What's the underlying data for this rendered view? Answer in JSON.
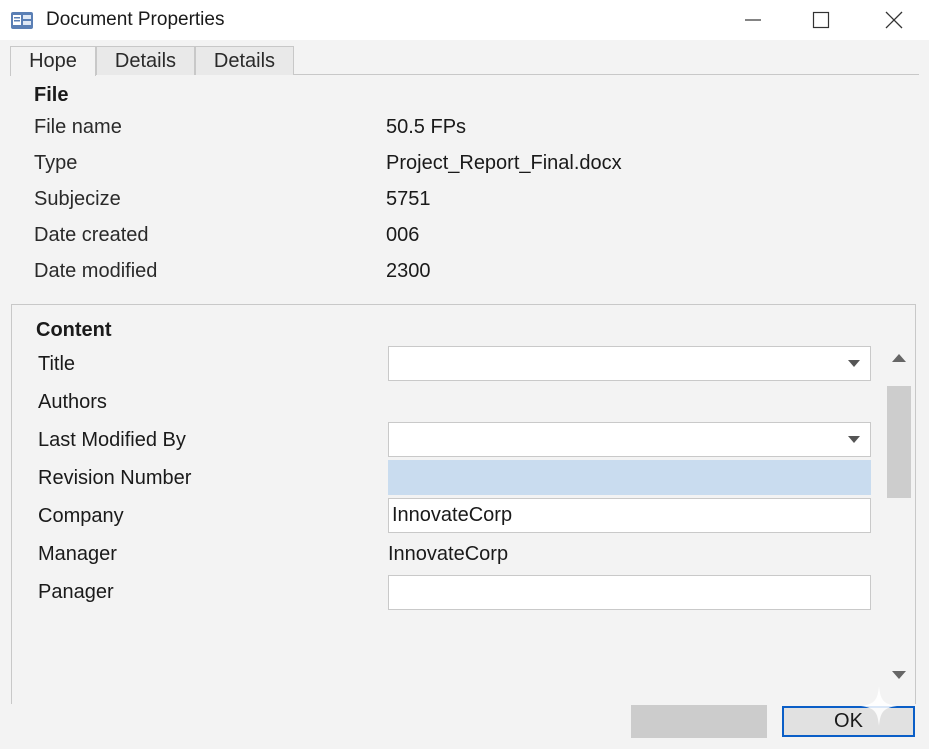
{
  "window": {
    "title": "Document Properties",
    "icon": "document-properties-icon"
  },
  "tabs": [
    {
      "label": "Hope",
      "active": true
    },
    {
      "label": "Details",
      "active": false
    },
    {
      "label": "Details",
      "active": false
    }
  ],
  "file_section": {
    "heading": "File",
    "rows": [
      {
        "label": "File name",
        "value": "50.5 FPs"
      },
      {
        "label": "Type",
        "value": "Project_Report_Final.docx"
      },
      {
        "label": "Subjecize",
        "value": "5751"
      },
      {
        "label": "Date created",
        "value": "006"
      },
      {
        "label": "Date modified",
        "value": "2300"
      }
    ]
  },
  "content_section": {
    "heading": "Content",
    "fields": [
      {
        "label": "Title",
        "value": "",
        "kind": "combo"
      },
      {
        "label": "Authors",
        "value": "",
        "kind": "none"
      },
      {
        "label": "Last Modified By",
        "value": "",
        "kind": "combo"
      },
      {
        "label": "Revision Number",
        "value": "",
        "kind": "selected"
      },
      {
        "label": "Company",
        "value": "InnovateCorp",
        "kind": "text"
      },
      {
        "label": "Manager",
        "value": "InnovateCorp",
        "kind": "plain"
      },
      {
        "label": "Panager",
        "value": "",
        "kind": "text"
      }
    ]
  },
  "buttons": {
    "blank": "",
    "ok": "OK"
  },
  "colors": {
    "background": "#f3f3f3",
    "selection": "#c9dcef",
    "ok_border": "#0a5ec7"
  }
}
